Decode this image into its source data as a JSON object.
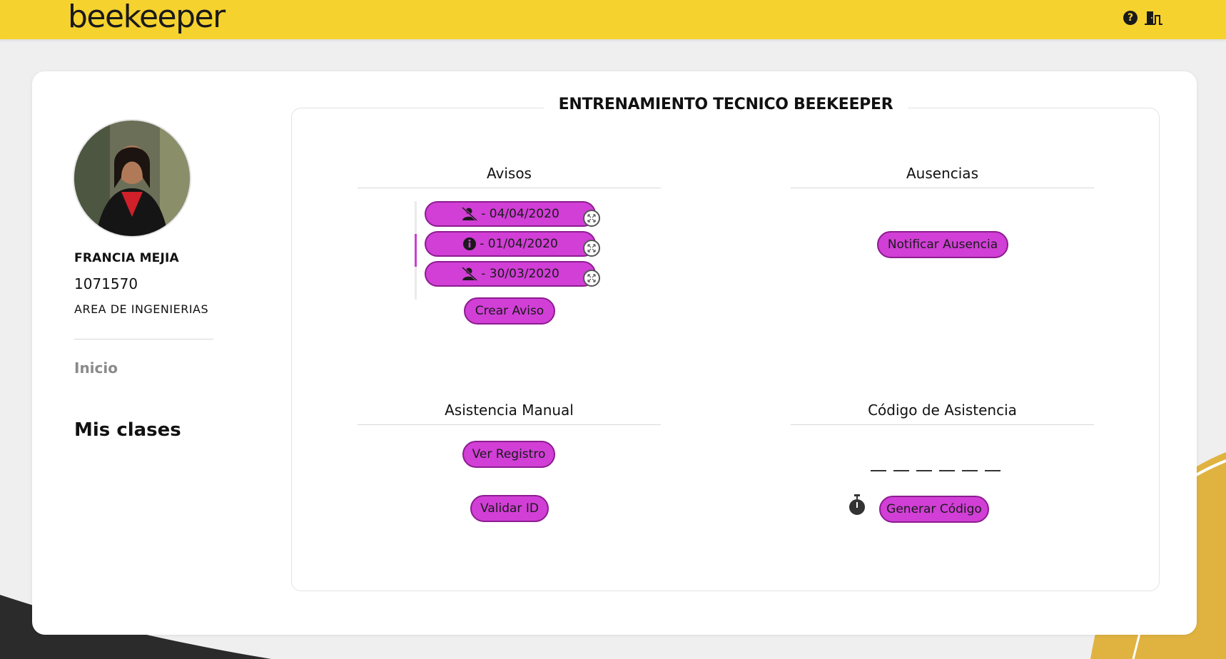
{
  "header": {
    "logo_text": "beekeeper",
    "help_icon": "question-circle-icon",
    "logout_icon": "door-exit-icon",
    "brand_color": "#f6d22f"
  },
  "sidebar": {
    "avatar_icon": "user-photo",
    "name": "FRANCIA MEJIA",
    "id": "1071570",
    "area": "AREA DE INGENIERIAS",
    "nav": {
      "home": "Inicio",
      "classes": "Mis clases"
    }
  },
  "main": {
    "title": "ENTRENAMIENTO TECNICO BEEKEEPER",
    "avisos": {
      "title": "Avisos",
      "items": [
        {
          "icon": "user-slash-icon",
          "label": "- 04/04/2020"
        },
        {
          "icon": "info-circle-icon",
          "label": "- 01/04/2020"
        },
        {
          "icon": "user-slash-icon",
          "label": "- 30/03/2020"
        }
      ],
      "create_button": "Crear Aviso"
    },
    "ausencias": {
      "title": "Ausencias",
      "notify_button": "Notificar Ausencia"
    },
    "asistencia_manual": {
      "title": "Asistencia Manual",
      "view_button": "Ver Registro",
      "validate_button": "Validar ID"
    },
    "codigo_asistencia": {
      "title": "Código de Asistencia",
      "generate_button": "Generar Código",
      "timer_icon": "stopwatch-icon"
    },
    "accent_color": "#d13fd6"
  }
}
